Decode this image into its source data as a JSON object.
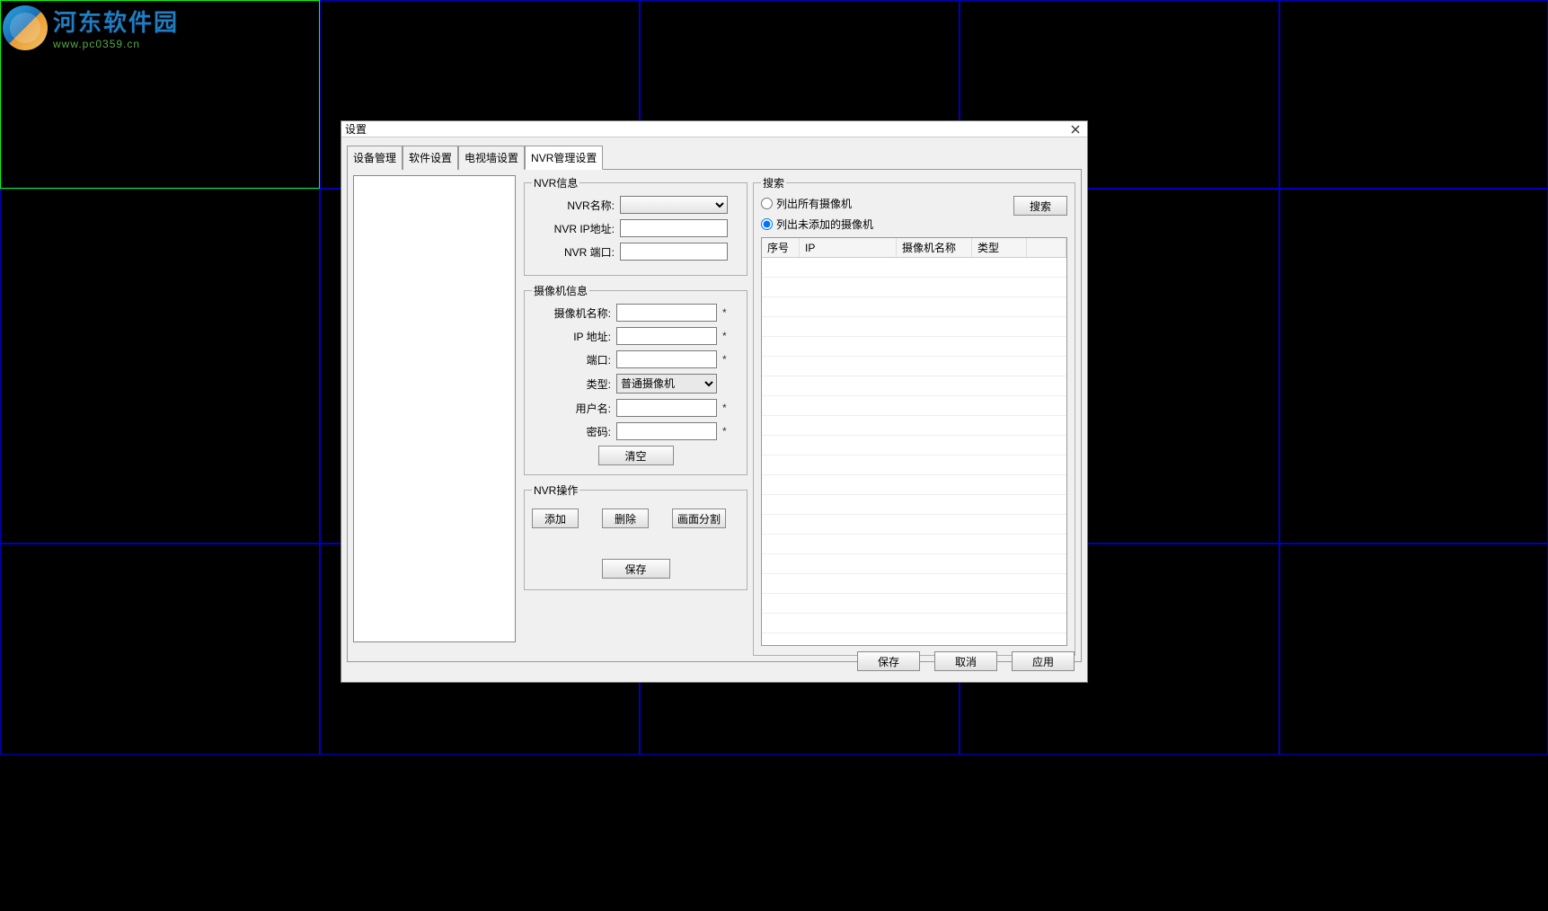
{
  "watermark": {
    "title": "河东软件园",
    "url": "www.pc0359.cn"
  },
  "dialog": {
    "title": "设置",
    "tabs": [
      "设备管理",
      "软件设置",
      "电视墙设置",
      "NVR管理设置"
    ],
    "active_tab_index": 3,
    "groups": {
      "nvr_info": {
        "legend": "NVR信息",
        "labels": {
          "name": "NVR名称:",
          "ip": "NVR IP地址:",
          "port": "NVR 端口:"
        },
        "values": {
          "name": "",
          "ip": "",
          "port": ""
        }
      },
      "camera_info": {
        "legend": "摄像机信息",
        "labels": {
          "name": "摄像机名称:",
          "ip": "IP 地址:",
          "port": "端口:",
          "type": "类型:",
          "user": "用户名:",
          "pass": "密码:"
        },
        "values": {
          "name": "",
          "ip": "",
          "port": "",
          "type": "普通摄像机",
          "user": "",
          "pass": ""
        },
        "type_options": [
          "普通摄像机"
        ],
        "required_mark": "*",
        "clear_btn": "清空"
      },
      "nvr_ops": {
        "legend": "NVR操作",
        "add": "添加",
        "delete": "删除",
        "split": "画面分割",
        "save": "保存"
      },
      "search": {
        "legend": "搜索",
        "opt_all": "列出所有摄像机",
        "opt_unadded": "列出未添加的摄像机",
        "selected": "unadded",
        "search_btn": "搜索",
        "columns": [
          "序号",
          "IP",
          "摄像机名称",
          "类型"
        ],
        "rows": []
      }
    },
    "footer": {
      "save": "保存",
      "cancel": "取消",
      "apply": "应用"
    }
  }
}
